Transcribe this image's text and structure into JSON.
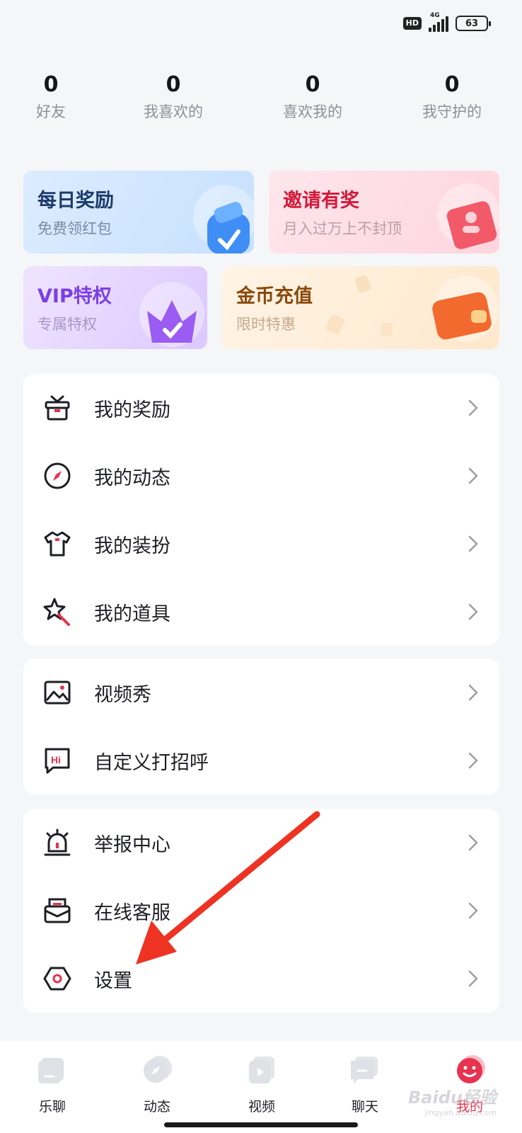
{
  "status_bar": {
    "hd": "HD",
    "network": "4G",
    "battery": "63"
  },
  "stats": [
    {
      "value": "0",
      "label": "好友"
    },
    {
      "value": "0",
      "label": "我喜欢的"
    },
    {
      "value": "0",
      "label": "喜欢我的"
    },
    {
      "value": "0",
      "label": "我守护的"
    }
  ],
  "promo_cards": {
    "daily_reward": {
      "title": "每日奖励",
      "subtitle": "免费领红包"
    },
    "invite": {
      "title": "邀请有奖",
      "subtitle": "月入过万上不封顶"
    },
    "vip": {
      "title": "VIP特权",
      "subtitle": "专属特权"
    },
    "coins": {
      "title": "金币充值",
      "subtitle": "限时特惠"
    }
  },
  "menu": {
    "group1": [
      "我的奖励",
      "我的动态",
      "我的装扮",
      "我的道具"
    ],
    "group2": [
      "视频秀",
      "自定义打招呼"
    ],
    "group3": [
      "举报中心",
      "在线客服",
      "设置"
    ]
  },
  "tabs": [
    "乐聊",
    "动态",
    "视频",
    "聊天",
    "我的"
  ],
  "watermark": {
    "brand": "Baidu经验",
    "url": "jingyan.baidu.com"
  },
  "colors": {
    "accent": "#e8334f",
    "arrow": "#ee3322",
    "background": "#f5f6f8"
  }
}
